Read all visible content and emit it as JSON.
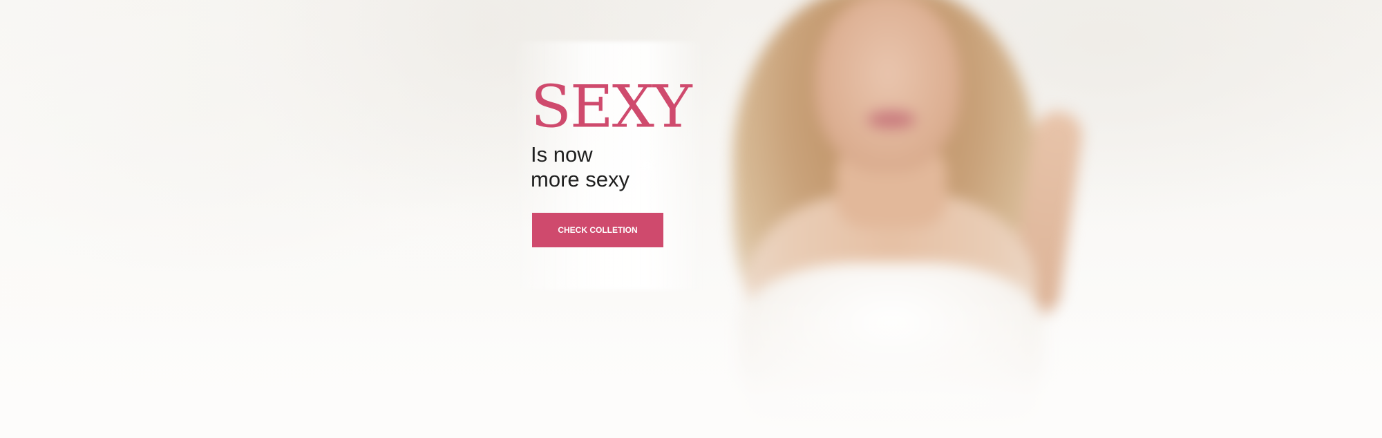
{
  "hero": {
    "headline": "SEXY",
    "subline_line1": "Is now",
    "subline_line2": "more sexy",
    "cta_label": "CHECK COLLETION"
  },
  "colors": {
    "accent": "#cf4a6d",
    "text": "#1f1f1f",
    "background": "#fbfaf8"
  }
}
